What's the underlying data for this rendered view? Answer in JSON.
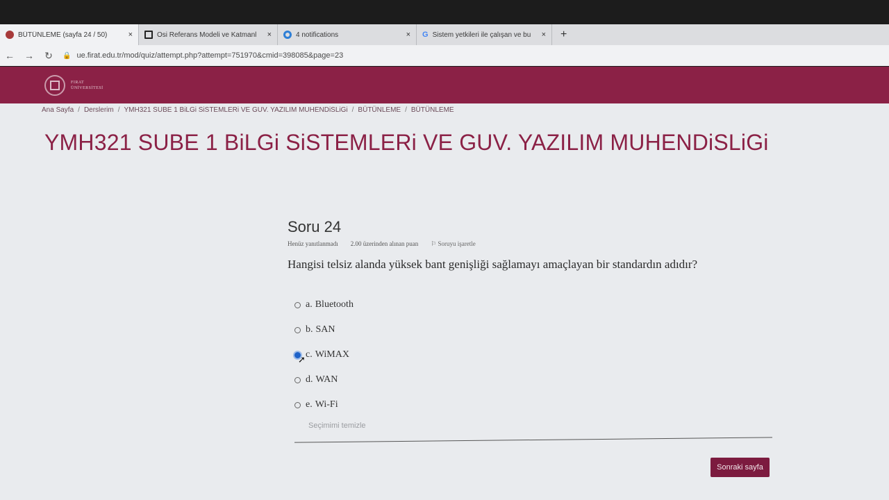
{
  "browser": {
    "tabs": [
      {
        "title": "BÜTÜNLEME (sayfa 24 / 50)",
        "icon": "moodle-favicon",
        "close": "×"
      },
      {
        "title": "Osi Referans Modeli ve Katmanl",
        "icon": "square-favicon",
        "close": "×"
      },
      {
        "title": "4 notifications",
        "icon": "bell-favicon",
        "close": "×"
      },
      {
        "title": "Sistem yetkileri ile çalışan ve bu",
        "icon": "google-favicon",
        "close": "×"
      }
    ],
    "new_tab": "+",
    "url": "ue.firat.edu.tr/mod/quiz/attempt.php?attempt=751970&cmid=398085&page=23"
  },
  "header": {
    "logo_line1": "FIRAT",
    "logo_line2": "ÜNİVERSİTESİ",
    "color": "#8b2146"
  },
  "breadcrumb": [
    "Ana Sayfa",
    "Derslerim",
    "YMH321 SUBE 1 BiLGi SiSTEMLERi VE GUV. YAZILIM MUHENDiSLiGi",
    "BÜTÜNLEME",
    "BÜTÜNLEME"
  ],
  "course_title": "YMH321 SUBE 1 BiLGi SiSTEMLERi VE GUV. YAZILIM MUHENDiSLiGi",
  "question": {
    "number": "Soru 24",
    "status": "Henüz yanıtlanmadı",
    "points": "2.00 üzerinden alınan puan",
    "flag": "Soruyu işaretle",
    "text": "Hangisi telsiz alanda yüksek bant genişliği sağlamayı amaçlayan bir standardın adıdır?",
    "answers": [
      {
        "letter": "a.",
        "text": "Bluetooth",
        "selected": false
      },
      {
        "letter": "b.",
        "text": "SAN",
        "selected": false
      },
      {
        "letter": "c.",
        "text": "WiMAX",
        "selected": true
      },
      {
        "letter": "d.",
        "text": "WAN",
        "selected": false
      },
      {
        "letter": "e.",
        "text": "Wi-Fi",
        "selected": false
      }
    ],
    "clear_choice": "Seçimimi temizle"
  },
  "next_button": "Sonraki sayfa"
}
